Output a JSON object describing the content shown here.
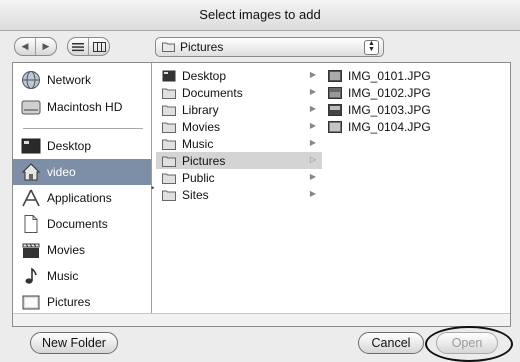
{
  "window": {
    "title": "Select images to add"
  },
  "toolbar": {
    "back_icon": "triangle-left-icon",
    "forward_icon": "triangle-right-icon",
    "list_view_icon": "list-view-icon",
    "column_view_icon": "column-view-icon",
    "location": "Pictures"
  },
  "sidebar": {
    "devices": [
      {
        "label": "Network",
        "icon": "network-globe-icon"
      },
      {
        "label": "Macintosh HD",
        "icon": "hard-drive-icon"
      }
    ],
    "places": [
      {
        "label": "Desktop",
        "icon": "desktop-icon"
      },
      {
        "label": "video",
        "icon": "home-icon",
        "selected": true
      },
      {
        "label": "Applications",
        "icon": "applications-icon"
      },
      {
        "label": "Documents",
        "icon": "document-icon"
      },
      {
        "label": "Movies",
        "icon": "clapperboard-icon"
      },
      {
        "label": "Music",
        "icon": "music-note-icon"
      },
      {
        "label": "Pictures",
        "icon": "picture-frame-icon"
      }
    ]
  },
  "column1": {
    "items": [
      {
        "label": "Desktop",
        "icon": "desktop-icon"
      },
      {
        "label": "Documents",
        "icon": "folder-icon"
      },
      {
        "label": "Library",
        "icon": "folder-icon"
      },
      {
        "label": "Movies",
        "icon": "folder-icon"
      },
      {
        "label": "Music",
        "icon": "folder-icon"
      },
      {
        "label": "Pictures",
        "icon": "folder-icon",
        "selected": true
      },
      {
        "label": "Public",
        "icon": "folder-icon"
      },
      {
        "label": "Sites",
        "icon": "folder-icon"
      }
    ]
  },
  "column2": {
    "items": [
      {
        "label": "IMG_0101.JPG",
        "icon": "jpeg-thumbnail-icon"
      },
      {
        "label": "IMG_0102.JPG",
        "icon": "jpeg-thumbnail-icon"
      },
      {
        "label": "IMG_0103.JPG",
        "icon": "jpeg-thumbnail-icon"
      },
      {
        "label": "IMG_0104.JPG",
        "icon": "jpeg-thumbnail-icon"
      }
    ]
  },
  "buttons": {
    "new_folder": "New Folder",
    "cancel": "Cancel",
    "open": "Open"
  },
  "colors": {
    "selection": "#7d8ea7",
    "column_selection": "#d4d4d4"
  }
}
